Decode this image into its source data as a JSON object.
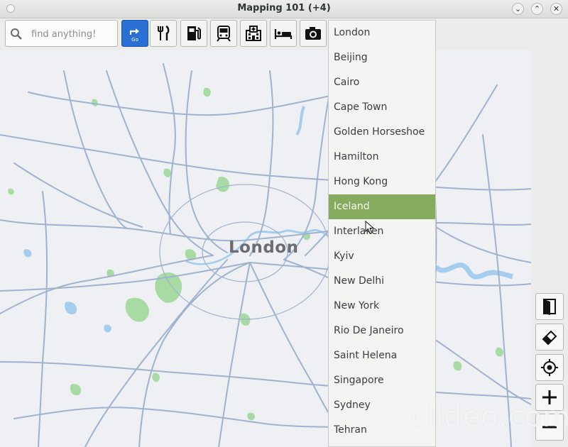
{
  "window": {
    "title": "Mapping 101 (+4)"
  },
  "search": {
    "placeholder": "find anything!",
    "value": ""
  },
  "toolbar": {
    "buttons": [
      {
        "name": "go-button",
        "icon": "go-arrow-icon",
        "label": "Go"
      },
      {
        "name": "restaurant-button",
        "icon": "fork-knife-icon"
      },
      {
        "name": "fuel-button",
        "icon": "fuel-pump-icon"
      },
      {
        "name": "transit-button",
        "icon": "train-icon"
      },
      {
        "name": "hospital-button",
        "icon": "hospital-icon"
      },
      {
        "name": "hotel-button",
        "icon": "bed-icon"
      },
      {
        "name": "attraction-button",
        "icon": "camera-icon"
      }
    ]
  },
  "map": {
    "place_label": "London"
  },
  "dropdown": {
    "selected": "Iceland",
    "items": [
      "London",
      "Beijing",
      "Cairo",
      "Cape Town",
      "Golden Horseshoe",
      "Hamilton",
      "Hong Kong",
      "Iceland",
      "Interlaken",
      "Kyiv",
      "New Delhi",
      "New York",
      "Rio De Janeiro",
      "Saint Helena",
      "Singapore",
      "Sydney",
      "Tehran"
    ]
  },
  "side_controls": [
    {
      "name": "exit-button",
      "icon": "door-icon"
    },
    {
      "name": "clear-button",
      "icon": "eraser-icon"
    },
    {
      "name": "locate-button",
      "icon": "crosshair-icon"
    },
    {
      "name": "zoom-in-button",
      "icon": "plus-icon"
    },
    {
      "name": "zoom-out-button",
      "icon": "minus-icon"
    }
  ],
  "watermark": "clideo.com",
  "colors": {
    "selection": "#86ab5f",
    "go_button": "#2a6fd4",
    "roads": "#9fb2d0",
    "parks": "#9fd79a",
    "water": "#9cc7ec"
  }
}
